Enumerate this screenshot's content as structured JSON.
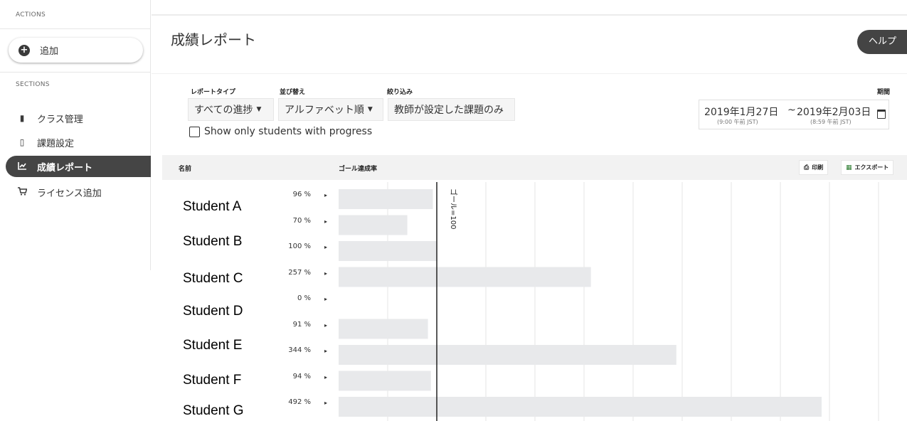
{
  "sidebar": {
    "actions_label": "ACTIONS",
    "add_label": "追加",
    "sections_label": "SECTIONS",
    "items": [
      {
        "label": "クラス管理",
        "icon": "clipboard-icon"
      },
      {
        "label": "課題設定",
        "icon": "book-icon"
      },
      {
        "label": "成績レポート",
        "icon": "chart-icon",
        "active": true
      },
      {
        "label": "ライセンス追加",
        "icon": "cart-icon"
      }
    ]
  },
  "header": {
    "title": "成績レポート",
    "help_label": "ヘルプ"
  },
  "controls": {
    "report_type_label": "レポートタイプ",
    "report_type_value": "すべての進捗",
    "sort_label": "並び替え",
    "sort_value": "アルファベット順",
    "filter_label": "絞り込み",
    "filter_value": "教師が設定した課題のみ",
    "period_label": "期間",
    "checkbox_label": "Show only students with progress",
    "start_date": "2019年1月27日",
    "start_time": "(9:00 午前 JST)",
    "date_sep": "~",
    "end_date": "2019年2月03日",
    "end_time": "(8:59 午前 JST)"
  },
  "table": {
    "col_name": "名前",
    "col_goal": "ゴール達成率",
    "print_label": "印刷",
    "export_label": "エクスポート",
    "goal_line_label": "ゴール=100"
  },
  "chart_data": {
    "type": "bar",
    "categories": [
      "Student A",
      "Student B",
      "Student C",
      "Student D",
      "Student E",
      "Student F",
      "Student G"
    ],
    "x_label_axis": "ゴール達成率",
    "goal": 100,
    "rows": [
      {
        "value": 96,
        "label": "96 %"
      },
      {
        "value": 70,
        "label": "70 %"
      },
      {
        "value": 100,
        "label": "100 %"
      },
      {
        "value": 257,
        "label": "257 %"
      },
      {
        "value": 0,
        "label": "0 %"
      },
      {
        "value": 91,
        "label": "91 %"
      },
      {
        "value": 344,
        "label": "344 %"
      },
      {
        "value": 94,
        "label": "94 %"
      },
      {
        "value": 492,
        "label": "492 %"
      }
    ],
    "colors": {
      "bar": "#e8e9eb",
      "grid": "#e5e5e5",
      "goal_line": "#222222"
    }
  }
}
